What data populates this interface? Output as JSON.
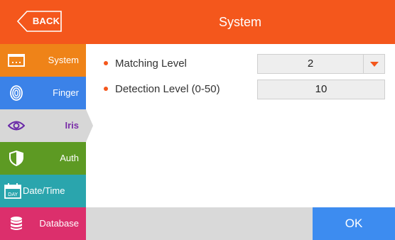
{
  "header": {
    "back_label": "BACK",
    "title": "System"
  },
  "sidebar": {
    "items": [
      {
        "label": "System",
        "icon": "keyboard-icon",
        "color": "#ef8318"
      },
      {
        "label": "Finger",
        "icon": "fingerprint-icon",
        "color": "#3b82e8"
      },
      {
        "label": "Iris",
        "icon": "eye-icon",
        "color": "#d7d7d7",
        "selected": true
      },
      {
        "label": "Auth",
        "icon": "shield-icon",
        "color": "#5d9a23"
      },
      {
        "label": "Date/Time",
        "icon": "calendar-day-icon",
        "color": "#2aa5ad"
      },
      {
        "label": "Database",
        "icon": "database-icon",
        "color": "#dc2f6c"
      }
    ]
  },
  "settings": {
    "matching_level": {
      "label": "Matching Level",
      "value": "2"
    },
    "detection_level": {
      "label": "Detection Level (0-50)",
      "value": "10"
    }
  },
  "footer": {
    "ok_label": "OK"
  },
  "colors": {
    "header": "#f4571c",
    "ok_button": "#3d8cf0"
  }
}
